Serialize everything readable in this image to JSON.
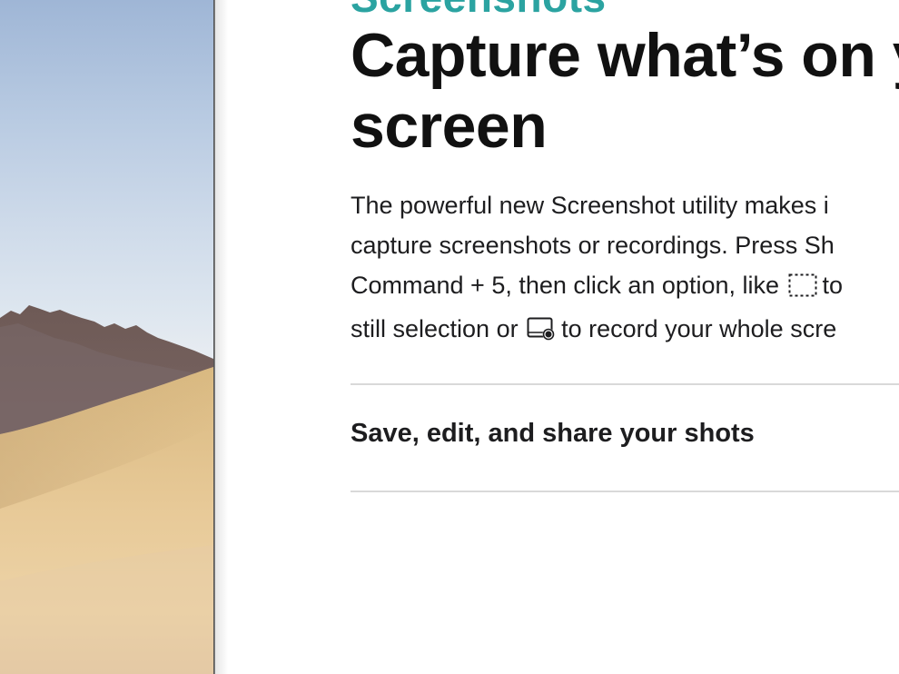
{
  "eyebrow": "Screenshots",
  "headline": {
    "line1": "Capture what’s on y",
    "line2": "screen"
  },
  "body": {
    "line1": "The powerful new Screenshot utility makes i",
    "line2": "capture screenshots or recordings. Press Sh",
    "line3_pre": "Command + 5, then click an option, like ",
    "line3_post": "to",
    "line4_pre": "still selection or ",
    "line4_post": "to record your whole scre"
  },
  "accordion": {
    "item_label": "Save, edit, and share your shots"
  },
  "icons": {
    "selection": "dashed-selection-icon",
    "record": "record-screen-icon"
  },
  "colors": {
    "eyebrow": "#2ba3a1",
    "headline": "#111111",
    "divider": "#d9d9d9"
  }
}
